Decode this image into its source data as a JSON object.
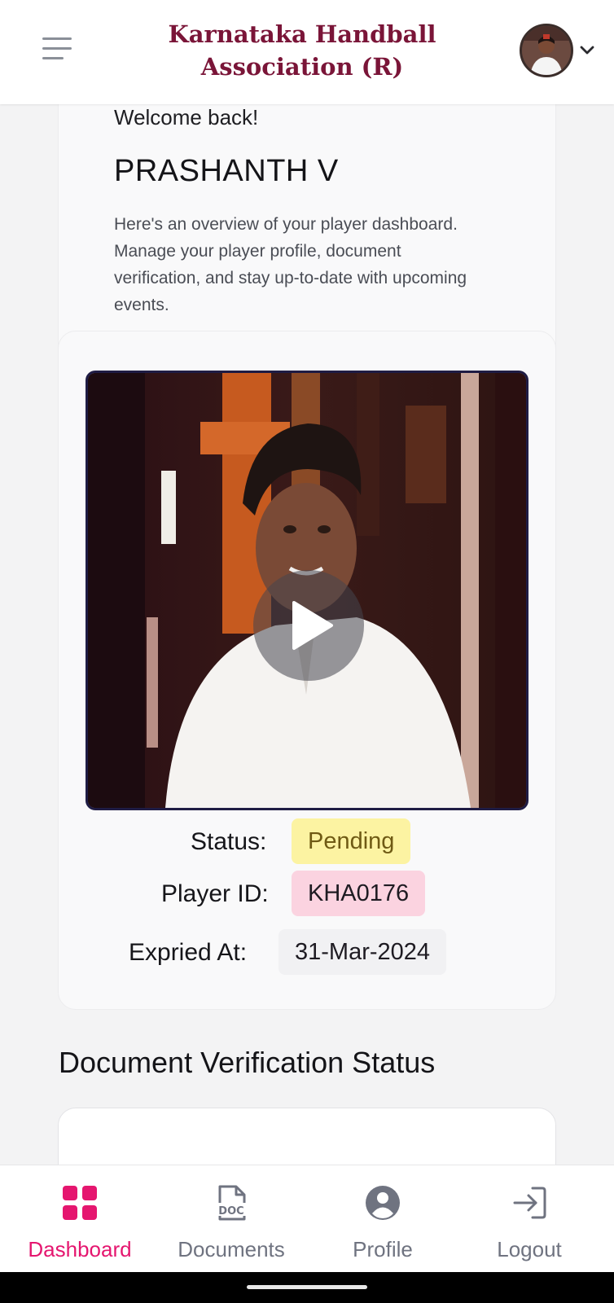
{
  "header": {
    "menu_icon": "hamburger-menu-icon",
    "brand_line1": "Karnataka Handball",
    "brand_line2": "Association (R)",
    "avatar_icon": "user-avatar",
    "dropdown_icon": "chevron-down-icon"
  },
  "welcome": {
    "greeting": "Welcome back!",
    "name": "PRASHANTH V",
    "overview": "Here's an overview of your player dashboard. Manage your player profile, document verification, and stay up-to-date with upcoming events."
  },
  "profile": {
    "video_icon": "play-icon",
    "status_label": "Status:",
    "status_value": "Pending",
    "player_id_label": "Player ID:",
    "player_id_value": "KHA0176",
    "expiry_label": "Expried At:",
    "expiry_value": "31-Mar-2024"
  },
  "documents_section": {
    "title": "Document Verification Status"
  },
  "bottom_nav": [
    {
      "label": "Dashboard",
      "icon": "dashboard-grid-icon",
      "active": true
    },
    {
      "label": "Documents",
      "icon": "document-doc-icon",
      "active": false
    },
    {
      "label": "Profile",
      "icon": "profile-user-icon",
      "active": false
    },
    {
      "label": "Logout",
      "icon": "logout-icon",
      "active": false
    }
  ],
  "colors": {
    "brand": "#7a1538",
    "accent": "#e5166f",
    "status_pending_bg": "#fcf3a2",
    "player_id_bg": "#fbd3e0"
  }
}
